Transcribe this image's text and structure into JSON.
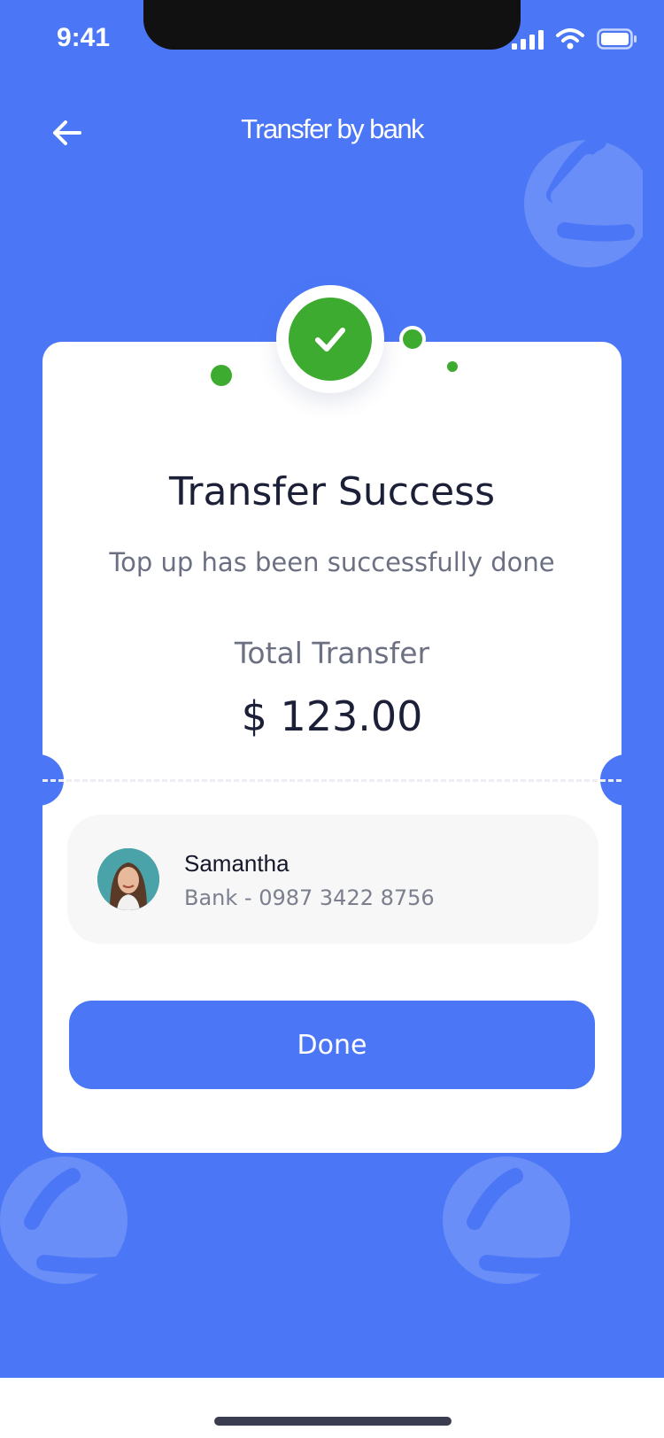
{
  "status_bar": {
    "time": "9:41",
    "icons": [
      "signal-icon",
      "wifi-icon",
      "battery-icon"
    ]
  },
  "header": {
    "title": "Transfer by bank",
    "back_icon": "arrow-left-icon"
  },
  "result": {
    "icon": "check-icon",
    "title": "Transfer Success",
    "subtitle": "Top up has been successfully done",
    "total_label": "Total Transfer",
    "amount": "$ 123.00"
  },
  "recipient": {
    "name": "Samantha",
    "detail": "Bank - 0987 3422 8756"
  },
  "actions": {
    "done_label": "Done"
  },
  "colors": {
    "background": "#4b77f7",
    "success": "#3dab2f",
    "card": "#ffffff",
    "text_dark": "#1c1f38",
    "text_muted": "#6c7083"
  }
}
